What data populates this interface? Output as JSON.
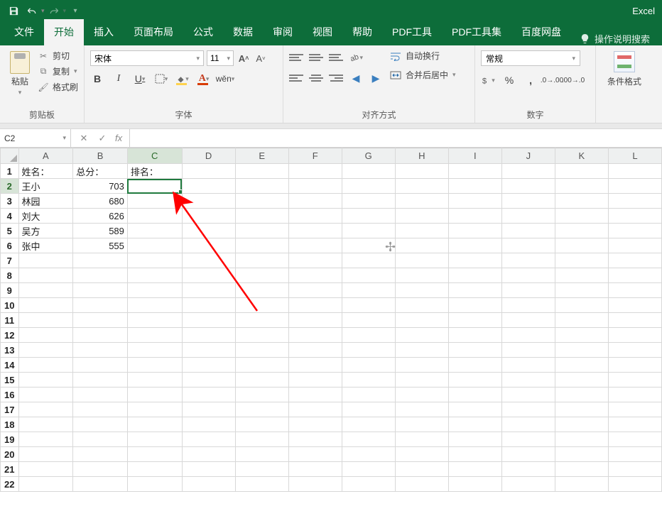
{
  "app": {
    "name": "Excel"
  },
  "qat": {
    "save": "save-icon",
    "undo": "undo-icon",
    "redo": "redo-icon"
  },
  "tabs": {
    "file": "文件",
    "home": "开始",
    "insert": "插入",
    "pageLayout": "页面布局",
    "formulas": "公式",
    "data": "数据",
    "review": "审阅",
    "view": "视图",
    "help": "帮助",
    "pdfTool": "PDF工具",
    "pdfSet": "PDF工具集",
    "baidu": "百度网盘",
    "tellMe": "操作说明搜索"
  },
  "ribbon": {
    "clipboard": {
      "paste": "粘贴",
      "cut": "剪切",
      "copy": "复制",
      "formatPainter": "格式刷",
      "groupLabel": "剪贴板"
    },
    "font": {
      "family": "宋体",
      "size": "11",
      "groupLabel": "字体"
    },
    "alignment": {
      "wrapText": "自动换行",
      "mergeCenter": "合并后居中",
      "groupLabel": "对齐方式"
    },
    "number": {
      "format": "常规",
      "groupLabel": "数字"
    },
    "styles": {
      "conditional": "条件格式"
    }
  },
  "nameBox": "C2",
  "formulaBar": "",
  "columns": [
    "A",
    "B",
    "C",
    "D",
    "E",
    "F",
    "G",
    "H",
    "I",
    "J",
    "K",
    "L"
  ],
  "headers": {
    "A": "姓名：",
    "B": "总分：",
    "C": "排名："
  },
  "data_rows": [
    {
      "name": "王小",
      "score": "703"
    },
    {
      "name": "林园",
      "score": "680"
    },
    {
      "name": "刘大",
      "score": "626"
    },
    {
      "name": "吴方",
      "score": "589"
    },
    {
      "name": "张中",
      "score": "555"
    }
  ],
  "chart_data": {
    "type": "table",
    "title": "",
    "columns": [
      "姓名",
      "总分",
      "排名"
    ],
    "rows": [
      [
        "王小",
        703,
        null
      ],
      [
        "林园",
        680,
        null
      ],
      [
        "刘大",
        626,
        null
      ],
      [
        "吴方",
        589,
        null
      ],
      [
        "张中",
        555,
        null
      ]
    ]
  },
  "selection": {
    "cell": "C2",
    "rowIndex": 2,
    "colIndex": 3
  }
}
